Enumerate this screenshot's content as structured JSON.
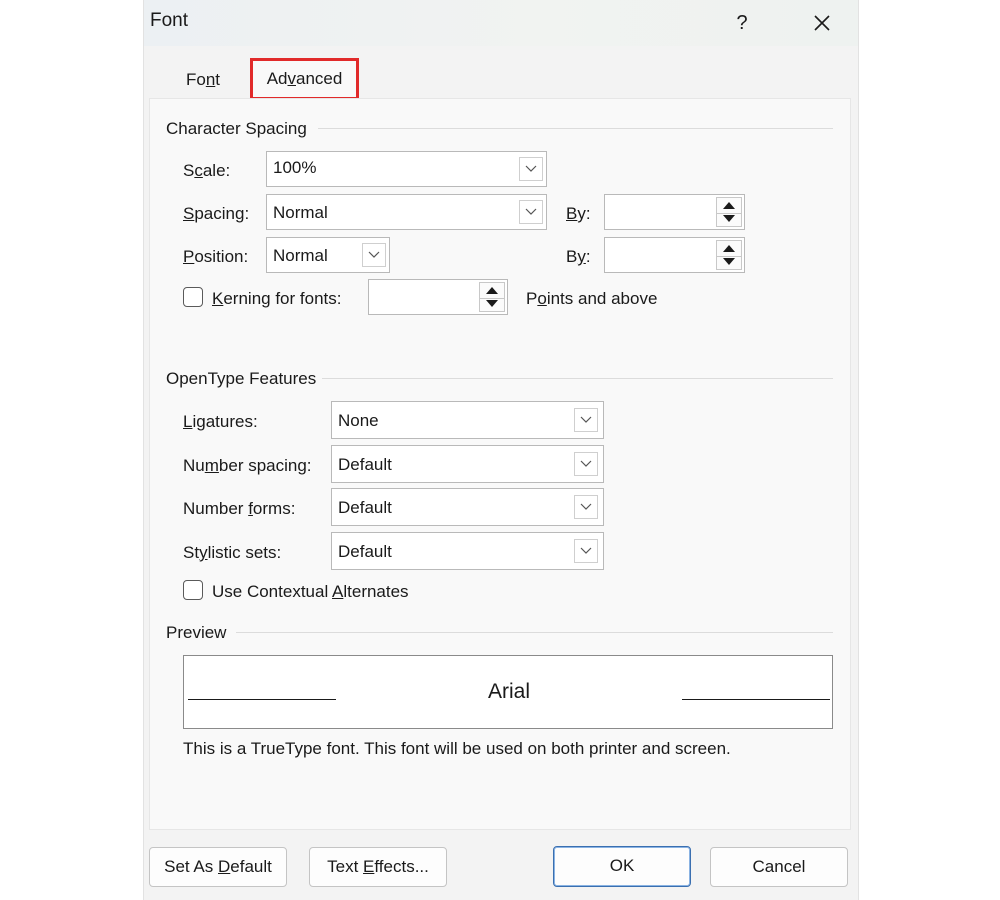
{
  "window": {
    "title": "Font",
    "help": "?"
  },
  "tabs": {
    "font": {
      "before": "Fo",
      "ul": "n",
      "after": "t"
    },
    "advanced": {
      "before": "Ad",
      "ul": "v",
      "after": "anced"
    }
  },
  "character_spacing": {
    "heading": "Character Spacing",
    "scale": {
      "label_before": "S",
      "label_ul": "c",
      "label_after": "ale:",
      "value": "100%"
    },
    "spacing": {
      "label_before": "",
      "label_ul": "S",
      "label_after": "pacing:",
      "value": "Normal"
    },
    "spacing_by": {
      "label_before": "",
      "label_ul": "B",
      "label_after": "y:",
      "value": ""
    },
    "position": {
      "label_before": "",
      "label_ul": "P",
      "label_after": "osition:",
      "value": "Normal"
    },
    "position_by": {
      "label_before": "B",
      "label_ul": "y",
      "label_after": ":",
      "value": ""
    },
    "kerning": {
      "label_before": "",
      "label_ul": "K",
      "label_after": "erning for fonts:",
      "value": "",
      "checked": false
    },
    "points_and_above": {
      "before": "P",
      "ul": "o",
      "after": "ints and above"
    }
  },
  "opentype": {
    "heading": "OpenType Features",
    "ligatures": {
      "label_before": "",
      "label_ul": "L",
      "label_after": "igatures:",
      "value": "None"
    },
    "number_spacing": {
      "label_before": "Nu",
      "label_ul": "m",
      "label_after": "ber spacing:",
      "value": "Default"
    },
    "number_forms": {
      "label_before": "Number ",
      "label_ul": "f",
      "label_after": "orms:",
      "value": "Default"
    },
    "stylistic_sets": {
      "label_before": "St",
      "label_ul": "y",
      "label_after": "listic sets:",
      "value": "Default"
    },
    "contextual": {
      "label_before": "Use Contextual ",
      "label_ul": "A",
      "label_after": "lternates",
      "checked": false
    }
  },
  "preview": {
    "heading": "Preview",
    "sample": "Arial",
    "note": "This is a TrueType font. This font will be used on both printer and screen."
  },
  "buttons": {
    "set_default": {
      "before": "Set As ",
      "ul": "D",
      "after": "efault"
    },
    "text_effects": {
      "before": "Text ",
      "ul": "E",
      "after": "ffects..."
    },
    "ok": "OK",
    "cancel": "Cancel"
  },
  "colors": {
    "highlight": "#e12a2a",
    "default_button_border": "#3a6fb0"
  }
}
